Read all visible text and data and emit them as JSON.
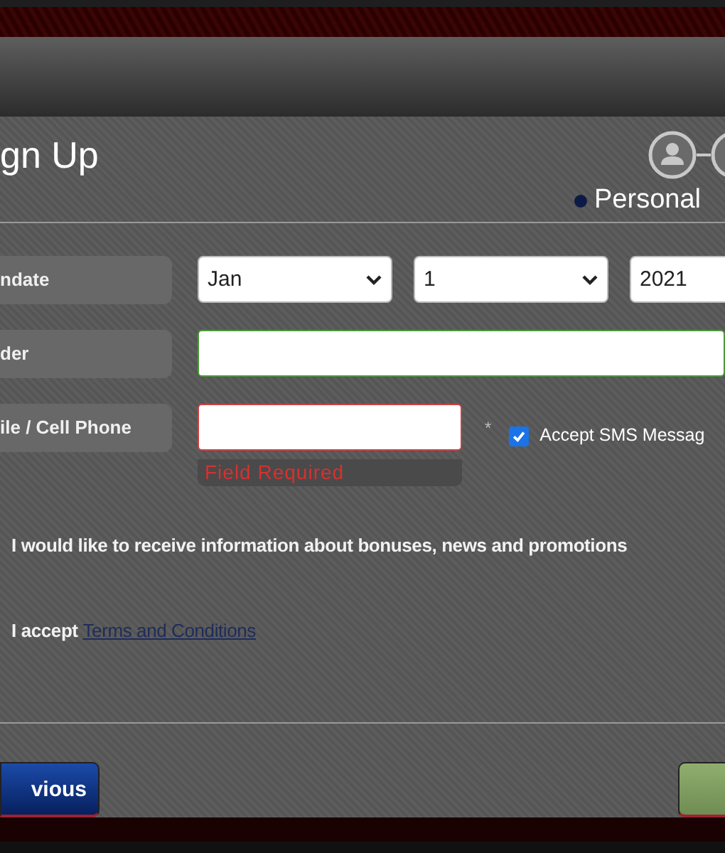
{
  "dialog": {
    "title": "gn Up"
  },
  "steps": {
    "items": [
      {
        "kind": "person"
      },
      {
        "kind": "blank"
      }
    ],
    "current_label": "Personal"
  },
  "fields": [
    {
      "kind": "selects",
      "label": "ndate",
      "selects": [
        "Jan",
        "1",
        "2021"
      ]
    },
    {
      "kind": "text",
      "label": "der",
      "valid": true
    },
    {
      "kind": "phone",
      "label": "ile / Cell Phone",
      "valid": false,
      "error": "Field Required",
      "required_mark": "*",
      "sms": {
        "label": "Accept SMS Messag",
        "checked": true
      }
    }
  ],
  "options": [
    {
      "kind": "plain",
      "text": "I would like to receive information about bonuses, news and promotions"
    },
    {
      "kind": "link",
      "text": "I accept",
      "link": "Terms and Conditions"
    }
  ],
  "buttons": [
    {
      "kind": "previous",
      "label": "vious"
    },
    {
      "kind": "next"
    }
  ]
}
